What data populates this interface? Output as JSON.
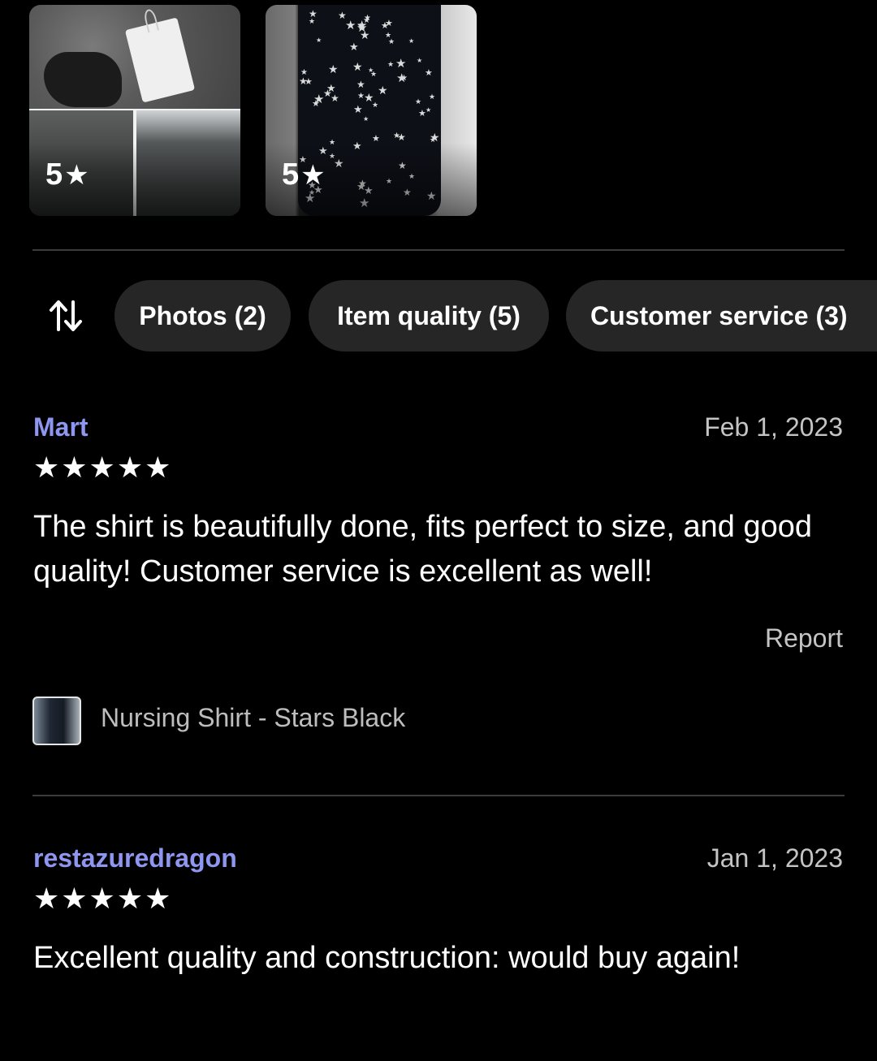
{
  "photos": [
    {
      "rating": "5",
      "description_icon": "star-icon"
    },
    {
      "rating": "5",
      "description_icon": "star-icon"
    }
  ],
  "filters": {
    "sort_icon": "sort-arrows-icon",
    "chips": [
      {
        "label": "Photos (2)"
      },
      {
        "label": "Item quality (5)"
      },
      {
        "label": "Customer service (3)"
      }
    ]
  },
  "reviews": [
    {
      "reviewer": "Mart",
      "date": "Feb 1, 2023",
      "stars": "★★★★★",
      "rating": 5,
      "text": "The shirt is beautifully done, fits perfect to size, and good quality! Customer service is excellent as well!",
      "report_label": "Report",
      "item_label": "Nursing Shirt - Stars Black"
    },
    {
      "reviewer": "restazuredragon",
      "date": "Jan 1, 2023",
      "stars": "★★★★★",
      "rating": 5,
      "text": "Excellent quality and construction: would buy again!"
    }
  ],
  "colors": {
    "background": "#000000",
    "chip_background": "#262626",
    "reviewer_name": "#8f96f0",
    "muted_text": "#c4c4c4",
    "divider": "#3b3b3b"
  }
}
